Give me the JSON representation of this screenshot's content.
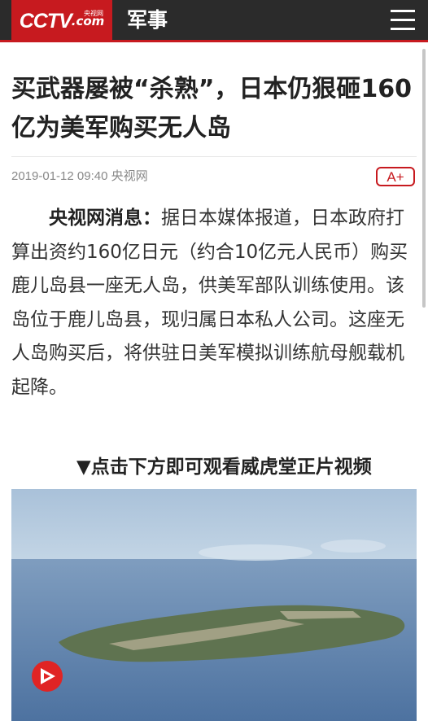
{
  "header": {
    "logo_main": "CCTV",
    "logo_suffix": ".com",
    "logo_cn": "央视网",
    "section": "军事",
    "menu_icon": "hamburger-menu-icon",
    "brand_color": "#c71a1f"
  },
  "article": {
    "title": "买武器屡被“杀熟”，日本仍狠砸160亿为美军购买无人岛",
    "meta": "2019-01-12 09:40 央视网",
    "font_size_button": "A+",
    "source_label": "央视网消息：",
    "body": "据日本媒体报道，日本政府打算出资约160亿日元（约合10亿元人民币）购买鹿儿岛县一座无人岛，供美军部队训练使用。该岛位于鹿儿岛县，现归属日本私人公司。这座无人岛购买后，将供驻日美军模拟训练航母舰载机起降。",
    "video_prompt": "▼点击下方即可观看威虎堂正片视频"
  },
  "video": {
    "play_icon": "play-icon"
  }
}
